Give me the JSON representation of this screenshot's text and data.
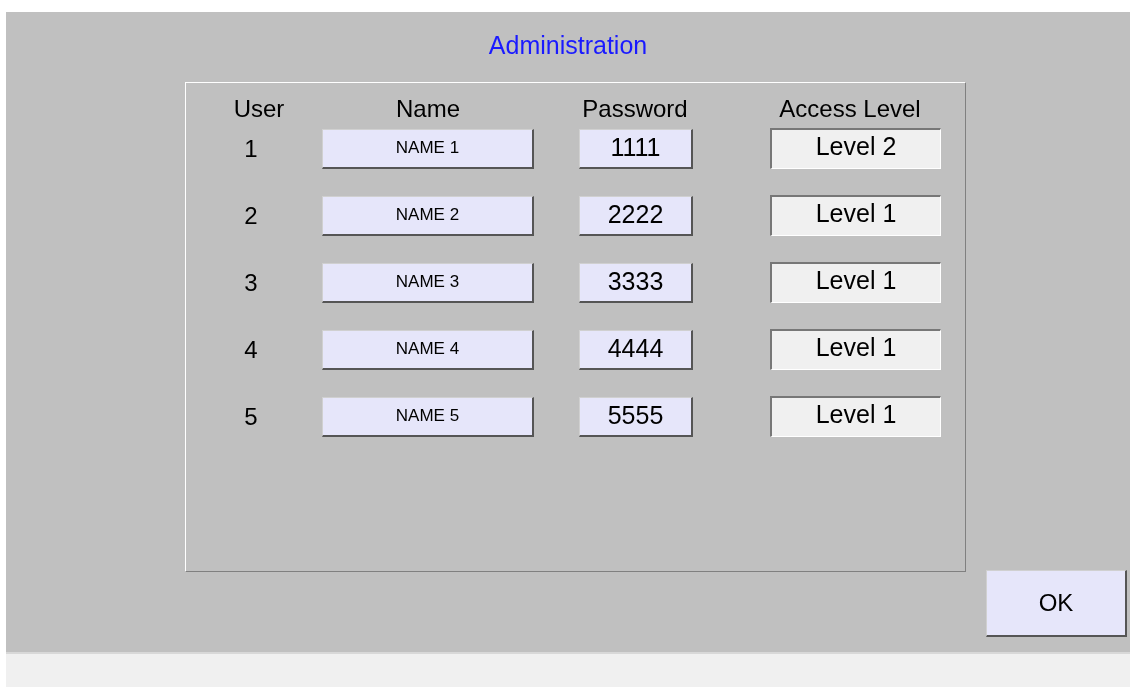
{
  "title": "Administration",
  "columns": [
    "User",
    "Name",
    "Password",
    "Access Level"
  ],
  "users": [
    {
      "user": "1",
      "name": "NAME 1",
      "password": "1111",
      "access_level": "Level 2"
    },
    {
      "user": "2",
      "name": "NAME 2",
      "password": "2222",
      "access_level": "Level 1"
    },
    {
      "user": "3",
      "name": "NAME 3",
      "password": "3333",
      "access_level": "Level 1"
    },
    {
      "user": "4",
      "name": "NAME 4",
      "password": "4444",
      "access_level": "Level 1"
    },
    {
      "user": "5",
      "name": "NAME 5",
      "password": "5555",
      "access_level": "Level 1"
    }
  ],
  "ok_button": "OK"
}
